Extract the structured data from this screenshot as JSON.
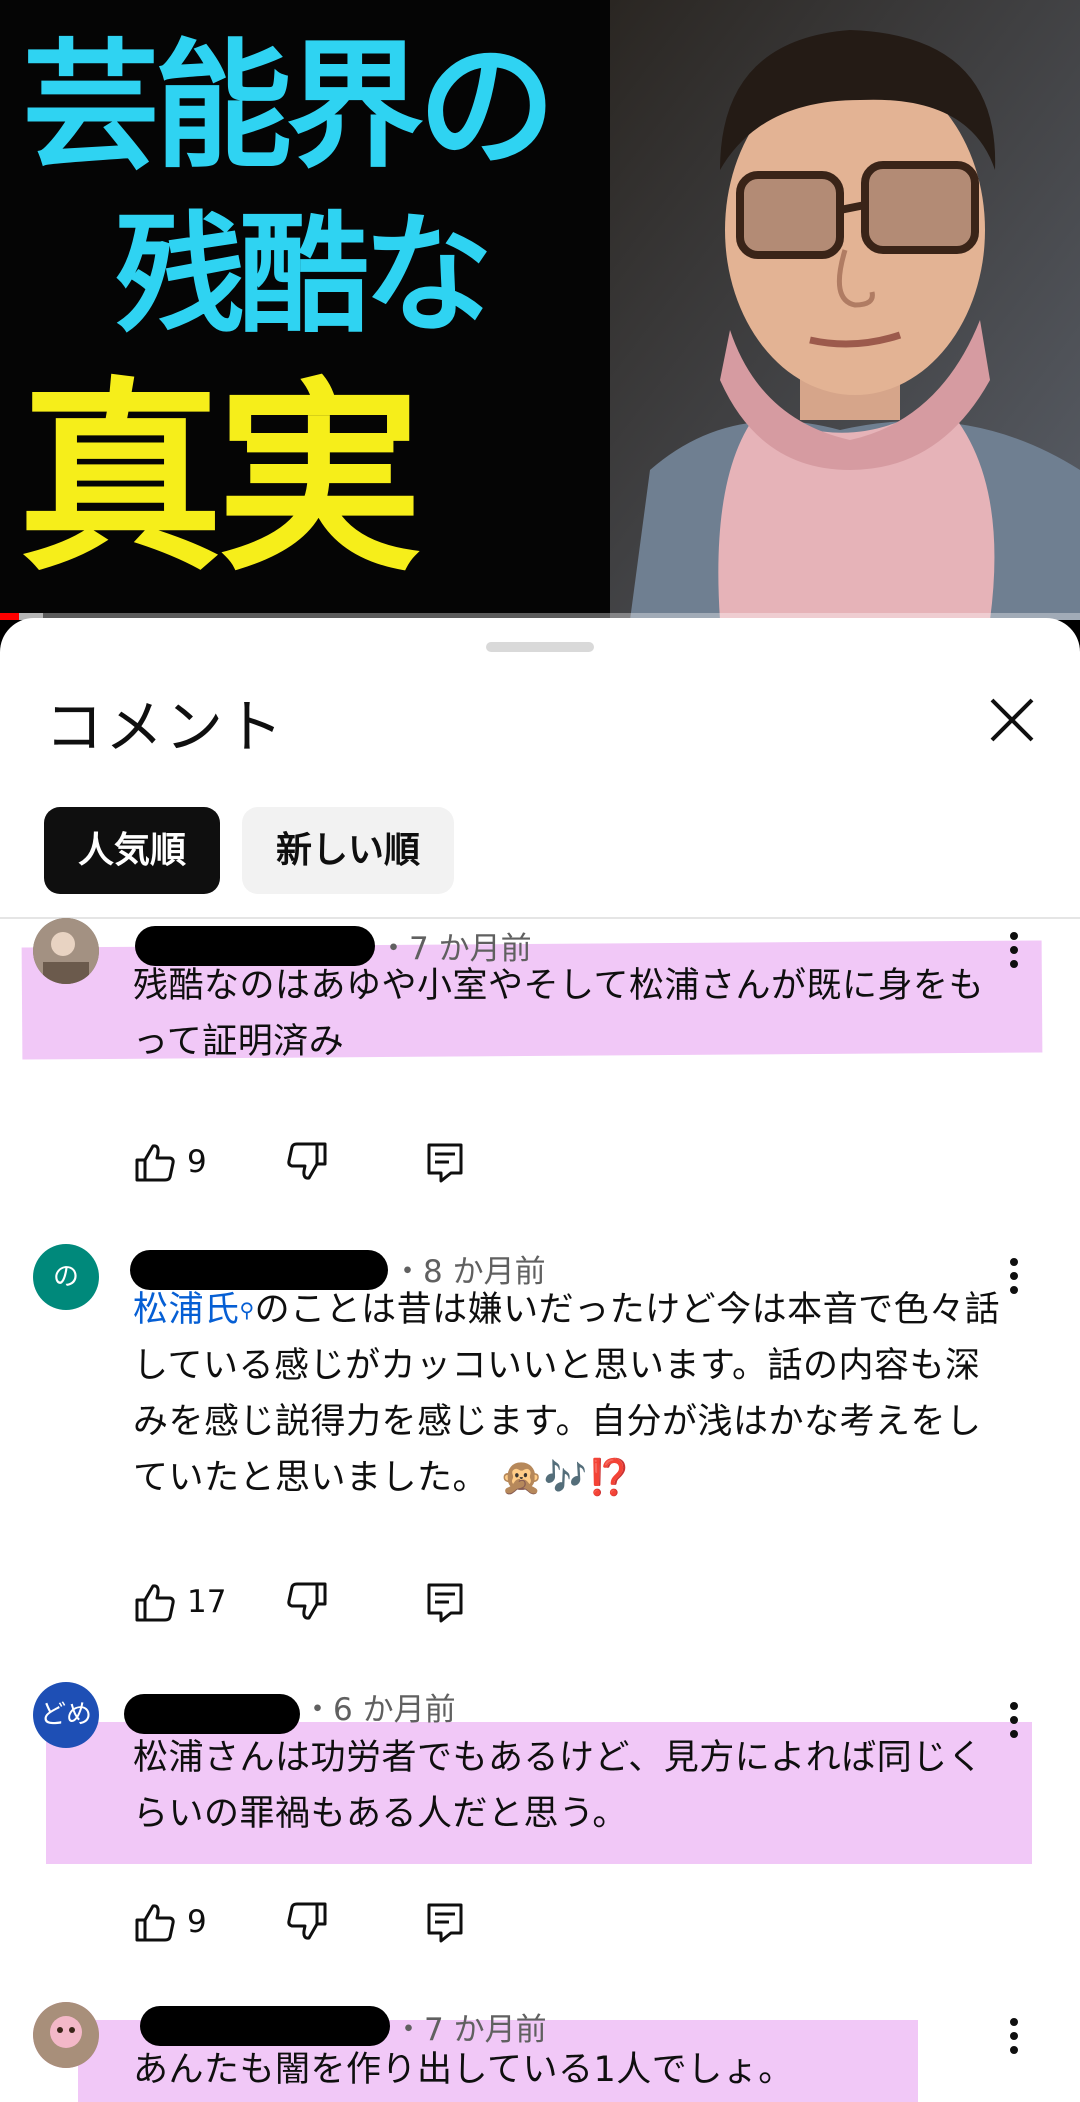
{
  "video": {
    "title_line1": "芸能界の",
    "title_line2": "残酷な",
    "title_line3": "真実",
    "progress_fraction": 0.018,
    "buffer_fraction": 0.04
  },
  "sheet": {
    "title": "コメント",
    "sort_chips": [
      {
        "label": "人気順",
        "selected": true
      },
      {
        "label": "新しい順",
        "selected": false
      }
    ]
  },
  "comments": [
    {
      "time": "・7 か月前",
      "text": "残酷なのはあゆや小室やそして松浦さんが既に身をもって証明済み",
      "likes": "9",
      "avatar_text": "",
      "avatar_color": "#8a7a6a"
    },
    {
      "time": "・8 か月前",
      "link_text": "松浦氏",
      "text": "のことは昔は嫌いだったけど今は本音で色々話している感じがカッコいいと思います。話の内容も深みを感じ説得力を感じます。自分が浅はかな考えをしていたと思いました。",
      "emojis": "🙊🎶⁉️",
      "likes": "17",
      "avatar_text": "の",
      "avatar_color": "#00897b"
    },
    {
      "time": "・6 か月前",
      "text": "松浦さんは功労者でもあるけど、見方によれば同じくらいの罪禍もある人だと思う。",
      "likes": "9",
      "avatar_text": "どめ",
      "avatar_color": "#1e4fb5"
    },
    {
      "time": "・7 か月前",
      "text": "あんたも闇を作り出している1人でしょ。",
      "likes": "",
      "avatar_text": "",
      "avatar_color": "#c98aa0"
    }
  ],
  "colors": {
    "highlight": "#f1c8f7",
    "title_cyan": "#2fd3f2",
    "title_yellow": "#f6ee1a",
    "link": "#065fd4"
  },
  "icons": [
    "close-icon",
    "like-icon",
    "dislike-icon",
    "reply-icon",
    "more-vert-icon"
  ]
}
